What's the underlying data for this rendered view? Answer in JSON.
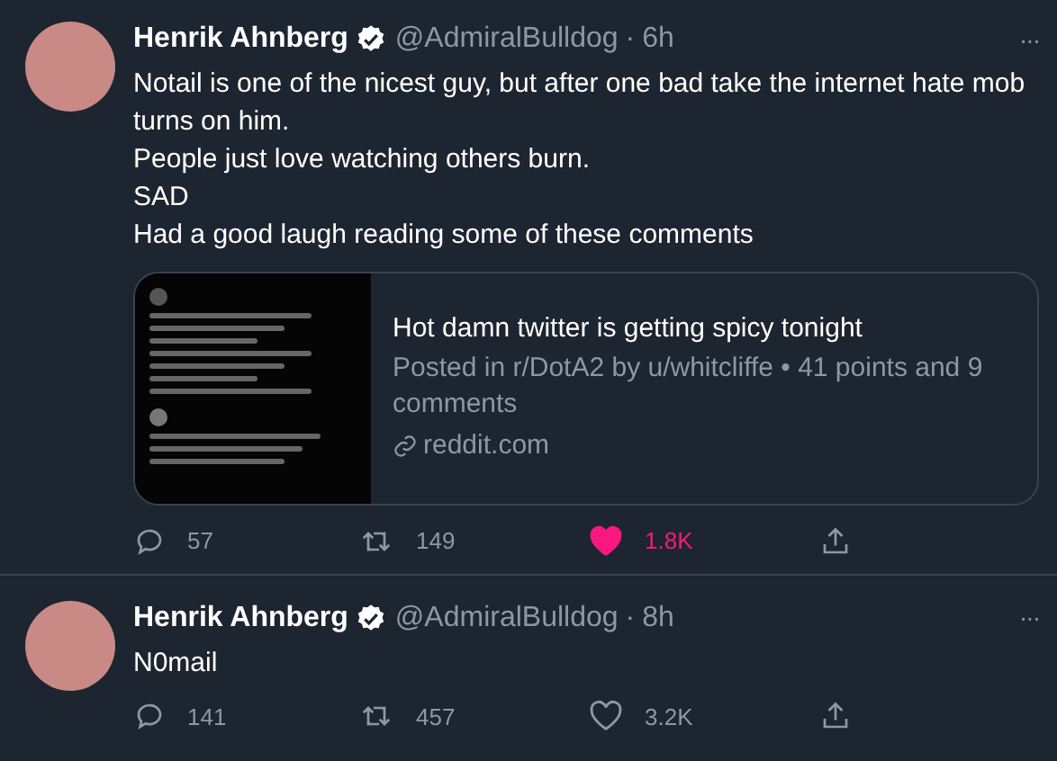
{
  "tweets": [
    {
      "name": "Henrik Ahnberg",
      "verified": true,
      "handle": "@AdmiralBulldog",
      "dot": "·",
      "time": "6h",
      "more": "···",
      "text": [
        "Notail is one of the nicest guy, but after one bad take the internet hate mob turns on him.",
        "People just love watching others burn.",
        "SAD",
        "Had a good laugh reading some of these comments"
      ],
      "card": {
        "title": "Hot damn twitter is getting spicy tonight",
        "description": "Posted in r/DotA2 by u/whitcliffe • 41 points and 9 comments",
        "domain": "reddit.com"
      },
      "actions": {
        "replies": "57",
        "retweets": "149",
        "likes": "1.8K",
        "liked": true
      }
    },
    {
      "name": "Henrik Ahnberg",
      "verified": true,
      "handle": "@AdmiralBulldog",
      "dot": "·",
      "time": "8h",
      "more": "···",
      "text": [
        "N0mail"
      ],
      "actions": {
        "replies": "141",
        "retweets": "457",
        "likes": "3.2K",
        "liked": false
      }
    }
  ]
}
